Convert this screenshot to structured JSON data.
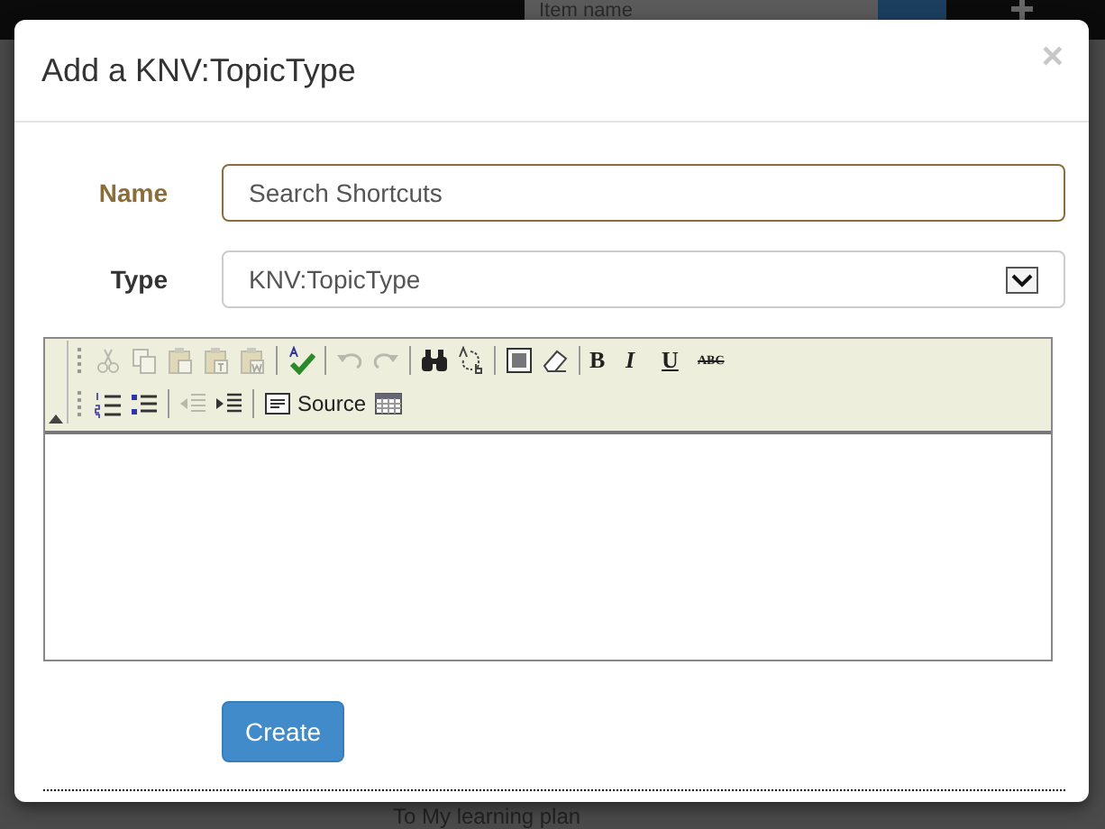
{
  "page": {
    "search": {
      "placeholder": "Item name"
    },
    "footer_text": "To My learning plan"
  },
  "dialog": {
    "title": "Add a KNV:TopicType",
    "close": "×",
    "fields": [
      {
        "kind": "text",
        "label": "Name",
        "value": "Search Shortcuts",
        "focused": true
      },
      {
        "kind": "select",
        "label": "Type",
        "value": "KNV:TopicType",
        "focused": false
      }
    ],
    "editor": {
      "toolbar_rows": [
        [
          {
            "buttons": [
              {
                "kind": "icon",
                "disabled": true
              },
              {
                "kind": "icon",
                "disabled": true
              },
              {
                "kind": "icon",
                "disabled": true
              },
              {
                "kind": "icon",
                "disabled": true
              },
              {
                "kind": "icon",
                "disabled": true
              }
            ]
          },
          {
            "buttons": [
              {
                "kind": "icon",
                "disabled": false
              }
            ]
          },
          {
            "buttons": [
              {
                "kind": "icon",
                "disabled": true
              },
              {
                "kind": "icon",
                "disabled": true
              }
            ]
          },
          {
            "buttons": [
              {
                "kind": "icon",
                "disabled": false
              },
              {
                "kind": "icon",
                "disabled": false
              }
            ]
          },
          {
            "buttons": [
              {
                "kind": "icon",
                "disabled": false
              },
              {
                "kind": "icon",
                "disabled": false
              }
            ]
          },
          {
            "buttons": [
              {
                "kind": "text",
                "label": "B",
                "disabled": false
              },
              {
                "kind": "text",
                "label": "I",
                "disabled": false
              },
              {
                "kind": "text",
                "label": "U",
                "disabled": false
              },
              {
                "kind": "text",
                "label": "ABC",
                "disabled": false
              }
            ]
          }
        ],
        [
          {
            "buttons": [
              {
                "kind": "icon",
                "disabled": false
              },
              {
                "kind": "icon",
                "disabled": false
              }
            ]
          },
          {
            "buttons": [
              {
                "kind": "icon",
                "disabled": true
              },
              {
                "kind": "icon",
                "disabled": false
              }
            ]
          },
          {
            "buttons": [
              {
                "kind": "icon_text",
                "label": "Source",
                "disabled": false
              },
              {
                "kind": "icon",
                "disabled": false
              }
            ]
          }
        ]
      ]
    },
    "buttons": [
      {
        "label": "Create"
      }
    ]
  }
}
